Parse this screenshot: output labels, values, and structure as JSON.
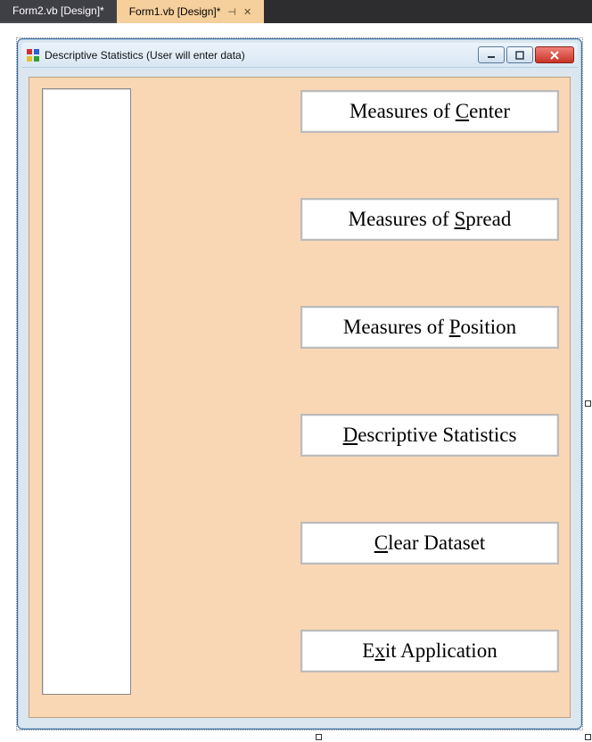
{
  "tabs": {
    "inactive_label": "Form2.vb [Design]*",
    "active_label": "Form1.vb [Design]*"
  },
  "window": {
    "title": "Descriptive Statistics (User will enter data)"
  },
  "buttons": {
    "center_pre": "Measures of ",
    "center_u": "C",
    "center_post": "enter",
    "spread_pre": "Measures of ",
    "spread_u": "S",
    "spread_post": "pread",
    "position_pre": "Measures of ",
    "position_u": "P",
    "position_post": "osition",
    "desc_u": "D",
    "desc_post": "escriptive Statistics",
    "clear_u": "C",
    "clear_post": "lear Dataset",
    "exit_pre": "E",
    "exit_u": "x",
    "exit_post": "it Application"
  }
}
